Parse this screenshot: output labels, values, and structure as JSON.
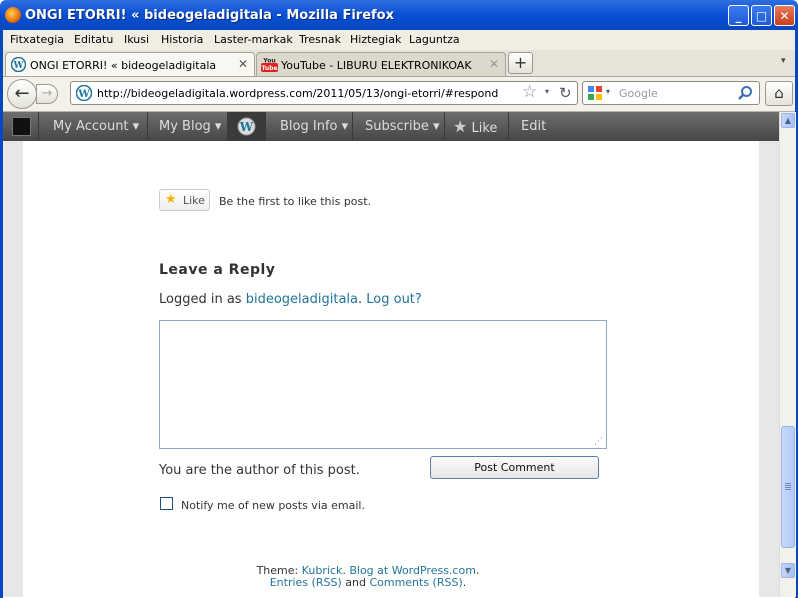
{
  "window": {
    "title": "ONGI ETORRI! « bideogeladigitala - Mozilla Firefox",
    "buttons": {
      "minimize": "_",
      "maximize": "□",
      "close": "✕"
    }
  },
  "menu": [
    "Fitxategia",
    "Editatu",
    "Ikusi",
    "Historia",
    "Laster-markak",
    "Tresnak",
    "Hiztegiak",
    "Laguntza"
  ],
  "tabs": [
    {
      "label": "ONGI ETORRI! « bideogeladigitala",
      "active": true
    },
    {
      "label": "YouTube - LIBURU ELEKTRONIKOAK",
      "active": false
    }
  ],
  "tab_new": "+",
  "tab_close": "✕",
  "nav": {
    "url": "http://bideogeladigitala.wordpress.com/2011/05/13/ongi-etorri/#respond",
    "search_placeholder": "Google"
  },
  "wpbar": {
    "my_account": "My Account ▾",
    "my_blog": "My Blog ▾",
    "blog_info": "Blog Info ▾",
    "subscribe": "Subscribe ▾",
    "like": "Like",
    "edit": "Edit"
  },
  "post": {
    "like_button": "Like",
    "like_text": "Be the first to like this post.",
    "reply_heading": "Leave a Reply",
    "logged_in_prefix": "Logged in as",
    "username": "bideogeladigitala",
    "logout": "Log out?",
    "author_note": "You are the author of this post.",
    "post_comment": "Post Comment",
    "notify_label": "Notify me of new posts via email."
  },
  "footer": {
    "theme_prefix": "Theme:",
    "theme_name": "Kubrick",
    "blog_at": "Blog at WordPress.com",
    "entries": "Entries (RSS)",
    "and": "and",
    "comments": "Comments (RSS)"
  }
}
